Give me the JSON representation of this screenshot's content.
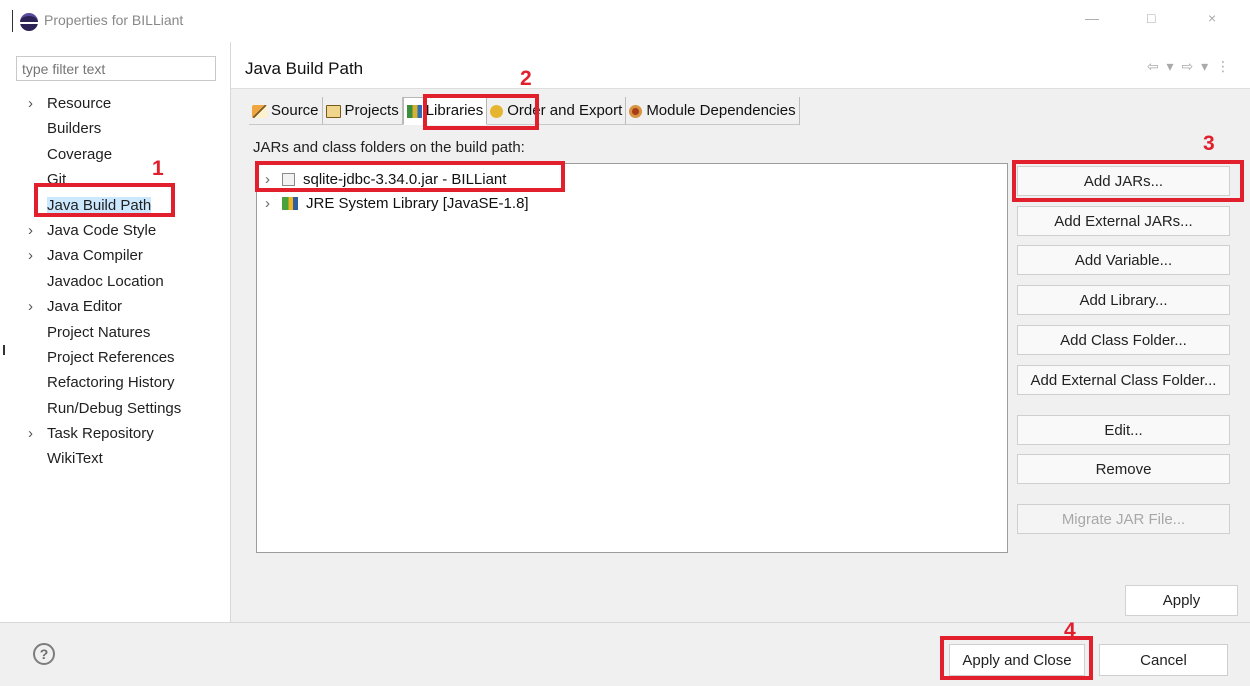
{
  "window": {
    "title": "Properties for BILLiant",
    "minimize": "—",
    "maximize": "□",
    "close": "×"
  },
  "sidebar": {
    "filter_placeholder": "type filter text",
    "items": [
      {
        "label": "Resource",
        "has_children": true
      },
      {
        "label": "Builders",
        "has_children": false
      },
      {
        "label": "Coverage",
        "has_children": false
      },
      {
        "label": "Git",
        "has_children": false
      },
      {
        "label": "Java Build Path",
        "has_children": false,
        "selected": true
      },
      {
        "label": "Java Code Style",
        "has_children": true
      },
      {
        "label": "Java Compiler",
        "has_children": true
      },
      {
        "label": "Javadoc Location",
        "has_children": false
      },
      {
        "label": "Java Editor",
        "has_children": true
      },
      {
        "label": "Project Natures",
        "has_children": false
      },
      {
        "label": "Project References",
        "has_children": false
      },
      {
        "label": "Refactoring History",
        "has_children": false
      },
      {
        "label": "Run/Debug Settings",
        "has_children": false
      },
      {
        "label": "Task Repository",
        "has_children": true
      },
      {
        "label": "WikiText",
        "has_children": false
      }
    ]
  },
  "header": {
    "title": "Java Build Path",
    "nav_glyphs": "⇦ ▾ ⇨ ▾ ⋮"
  },
  "tabs": [
    {
      "label": "Source",
      "icon": "source-folder-icon"
    },
    {
      "label": "Projects",
      "icon": "projects-icon"
    },
    {
      "label": "Libraries",
      "icon": "libraries-icon",
      "active": true
    },
    {
      "label": "Order and Export",
      "icon": "order-export-icon"
    },
    {
      "label": "Module Dependencies",
      "icon": "module-dependencies-icon"
    }
  ],
  "main": {
    "section_label": "JARs and class folders on the build path:",
    "entries": [
      {
        "label": "sqlite-jdbc-3.34.0.jar - BILLiant",
        "icon": "jar-file-icon"
      },
      {
        "label": "JRE System Library [JavaSE-1.8]",
        "icon": "jre-library-icon"
      }
    ],
    "buttons": {
      "add_jars": "Add JARs...",
      "add_external_jars": "Add External JARs...",
      "add_variable": "Add Variable...",
      "add_library": "Add Library...",
      "add_class_folder": "Add Class Folder...",
      "add_external_class_folder": "Add External Class Folder...",
      "edit": "Edit...",
      "remove": "Remove",
      "migrate_jar_file": "Migrate JAR File..."
    },
    "apply": "Apply"
  },
  "footer": {
    "help": "?",
    "apply_and_close": "Apply and Close",
    "cancel": "Cancel"
  },
  "annotations": {
    "step_1": "1",
    "step_2": "2",
    "step_3": "3",
    "step_4": "4",
    "color": "#e11f2d"
  }
}
